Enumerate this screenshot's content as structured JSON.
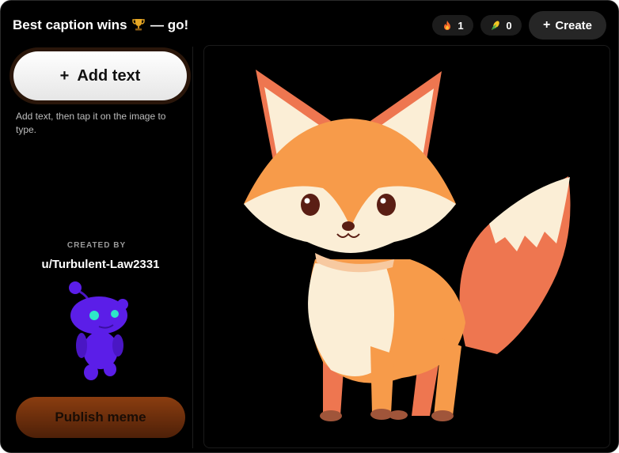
{
  "header": {
    "title_prefix": "Best caption wins",
    "title_suffix": "— go!",
    "title_icon": "trophy-icon",
    "fire_count": "1",
    "corn_count": "0",
    "create_label": "Create"
  },
  "sidebar": {
    "add_text_label": "Add text",
    "hint": "Add text, then tap it on the image to type.",
    "created_by_label": "CREATED BY",
    "username": "u/Turbulent-Law2331",
    "publish_label": "Publish meme"
  },
  "colors": {
    "background": "#000000",
    "publish_button": "#7a3510",
    "fox_orange": "#f79b4a",
    "fox_cream": "#fbeed6",
    "snoo": "#5b1ee8"
  }
}
